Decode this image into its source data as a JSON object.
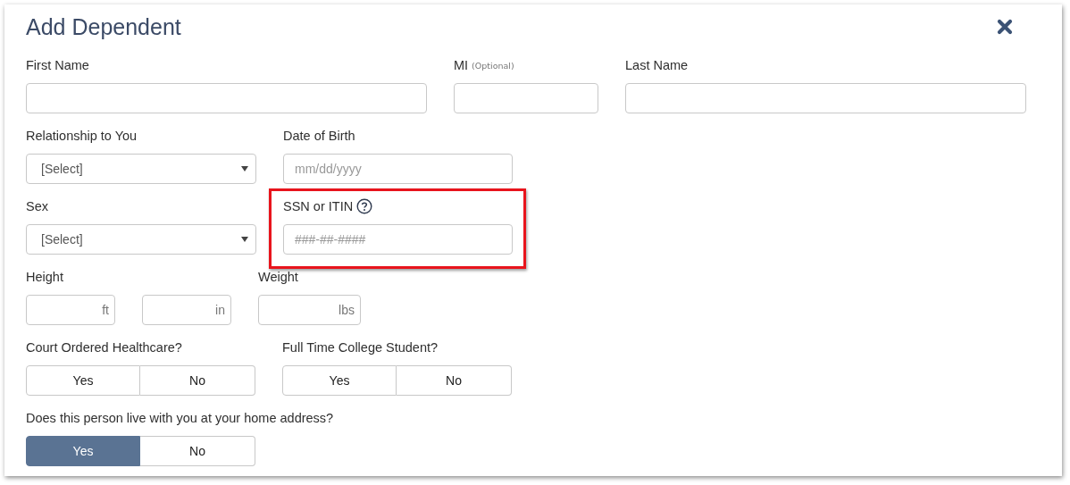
{
  "dialog": {
    "title": "Add Dependent"
  },
  "rows": [
    {
      "fields": [
        {
          "kind": "text",
          "label": "First Name"
        },
        {
          "kind": "text",
          "label": "MI",
          "note": "(Optional)"
        },
        {
          "kind": "text",
          "label": "Last Name"
        }
      ]
    },
    {
      "fields": [
        {
          "kind": "select",
          "label": "Relationship to You",
          "value": "[Select]"
        },
        {
          "kind": "text",
          "label": "Date of Birth",
          "placeholder": "mm/dd/yyyy"
        }
      ]
    },
    {
      "fields": [
        {
          "kind": "select",
          "label": "Sex",
          "value": "[Select]"
        },
        {
          "kind": "text",
          "label": "SSN or ITIN",
          "help": true,
          "highlighted": true,
          "placeholder": "###-##-####"
        }
      ]
    },
    {
      "fields": [
        {
          "kind": "units",
          "label": "Height",
          "units": [
            "ft",
            "in"
          ]
        },
        {
          "kind": "units",
          "label": "Weight",
          "units": [
            "lbs"
          ]
        }
      ]
    },
    {
      "fields": [
        {
          "kind": "toggle",
          "label": "Court Ordered Healthcare?",
          "options": [
            {
              "label": "Yes",
              "selected": false
            },
            {
              "label": "No",
              "selected": false
            }
          ]
        },
        {
          "kind": "toggle",
          "label": "Full Time College Student?",
          "options": [
            {
              "label": "Yes",
              "selected": false
            },
            {
              "label": "No",
              "selected": false
            }
          ]
        }
      ]
    },
    {
      "fields": [
        {
          "kind": "toggle",
          "label": "Does this person live with you at your home address?",
          "options": [
            {
              "label": "Yes",
              "selected": true
            },
            {
              "label": "No",
              "selected": false
            }
          ]
        }
      ]
    }
  ]
}
